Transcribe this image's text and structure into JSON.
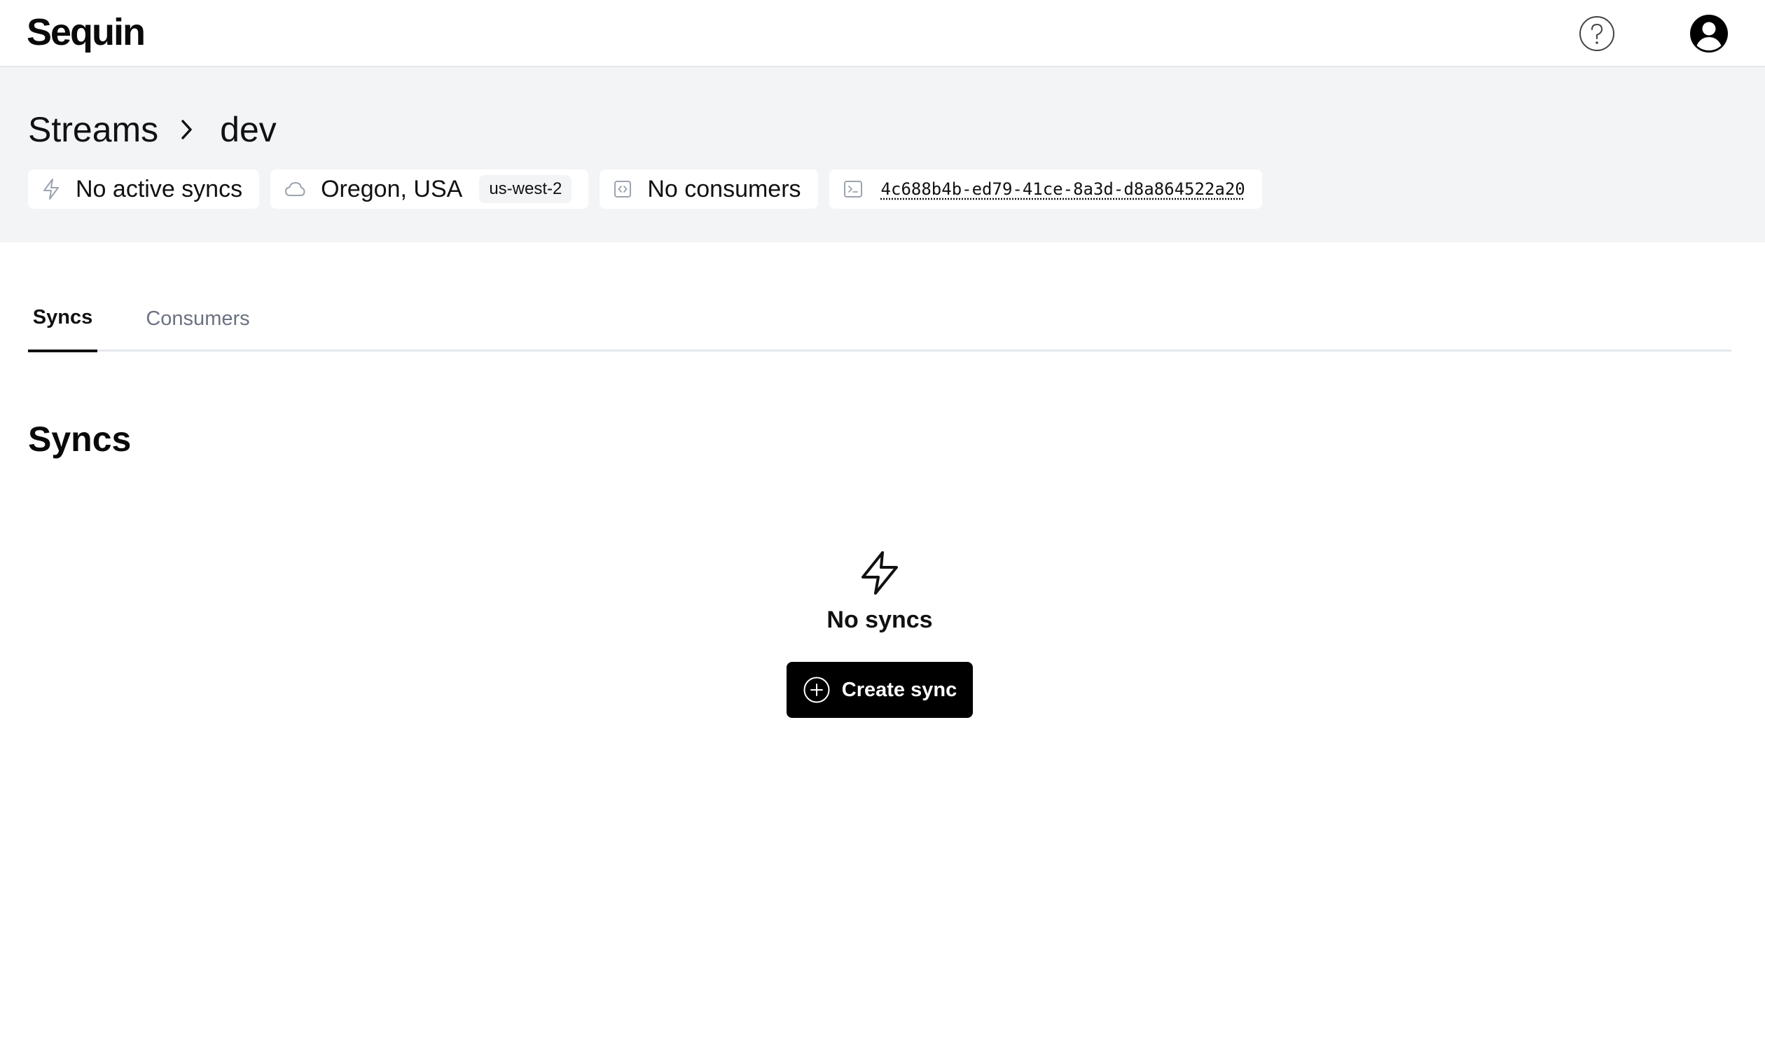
{
  "app": {
    "logo": "Sequin"
  },
  "topbar": {
    "help_icon": "help-circle-icon",
    "account_icon": "user-circle-icon"
  },
  "breadcrumb": {
    "parent": "Streams",
    "current": "dev"
  },
  "badges": {
    "syncs": {
      "icon": "bolt-icon",
      "label": "No active syncs"
    },
    "region": {
      "icon": "cloud-icon",
      "label": "Oregon, USA",
      "code": "us-west-2"
    },
    "consumers": {
      "icon": "code-box-icon",
      "label": "No consumers"
    },
    "stream_id": {
      "icon": "terminal-icon",
      "value": "4c688b4b-ed79-41ce-8a3d-d8a864522a20"
    }
  },
  "tabs": [
    {
      "label": "Syncs",
      "active": true
    },
    {
      "label": "Consumers",
      "active": false
    }
  ],
  "section": {
    "title": "Syncs"
  },
  "empty_state": {
    "icon": "bolt-icon",
    "title": "No syncs",
    "button_label": "Create sync",
    "button_icon": "plus-circle-icon"
  },
  "colors": {
    "header_bg": "#f3f4f6",
    "primary": "#000000",
    "muted_text": "#6b7280"
  }
}
